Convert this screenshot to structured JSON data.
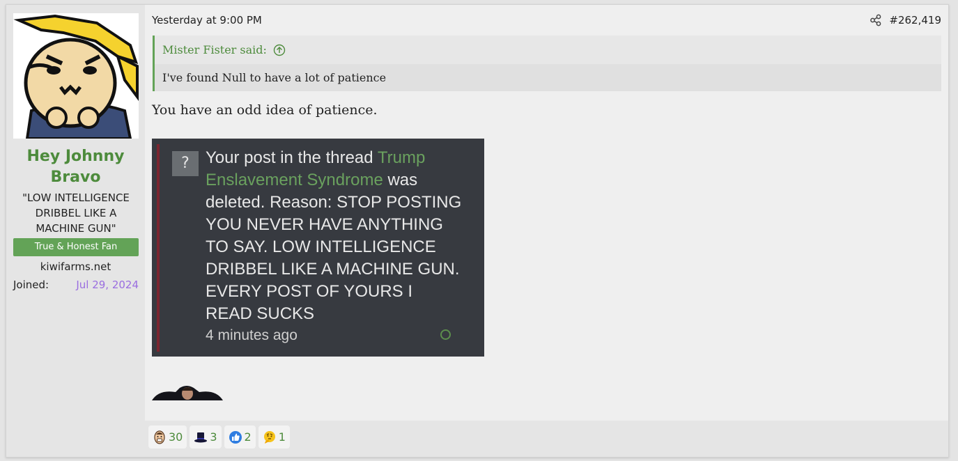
{
  "user": {
    "name": "Hey Johnny Bravo",
    "title": "\"LOW INTELLIGENCE DRIBBEL LIKE A MACHINE GUN\"",
    "banner": "True & Honest Fan",
    "site": "kiwifarms.net",
    "joined_label": "Joined:",
    "joined_date": "Jul 29, 2024"
  },
  "post": {
    "date": "Yesterday at 9:00 PM",
    "number": "#262,419",
    "message": "You have an odd idea of patience."
  },
  "quote": {
    "author_said": "Mister Fister said:",
    "text": "I've found Null to have a lot of patience"
  },
  "screenshot": {
    "q_glyph": "?",
    "text_before": "Your post in the thread ",
    "thread_link": "Trump Enslavement Syndrome",
    "text_after": " was deleted. Reason: STOP POSTING YOU NEVER HAVE ANYTHING TO SAY. LOW INTELLIGENCE DRIBBEL LIKE A MACHINE GUN. EVERY POST OF YOURS I READ SUCKS",
    "time_ago": "4 minutes ago"
  },
  "reactions": [
    {
      "icon": "laughing-face-icon",
      "count": "30"
    },
    {
      "icon": "top-hat-icon",
      "count": "3"
    },
    {
      "icon": "thumbs-up-icon",
      "count": "2"
    },
    {
      "icon": "thinking-face-icon",
      "count": "1"
    }
  ],
  "colors": {
    "accent_green": "#4d8b3c",
    "banner_green": "#63a357",
    "joined_purple": "#9a6ee0",
    "post_bg": "#efefef"
  }
}
